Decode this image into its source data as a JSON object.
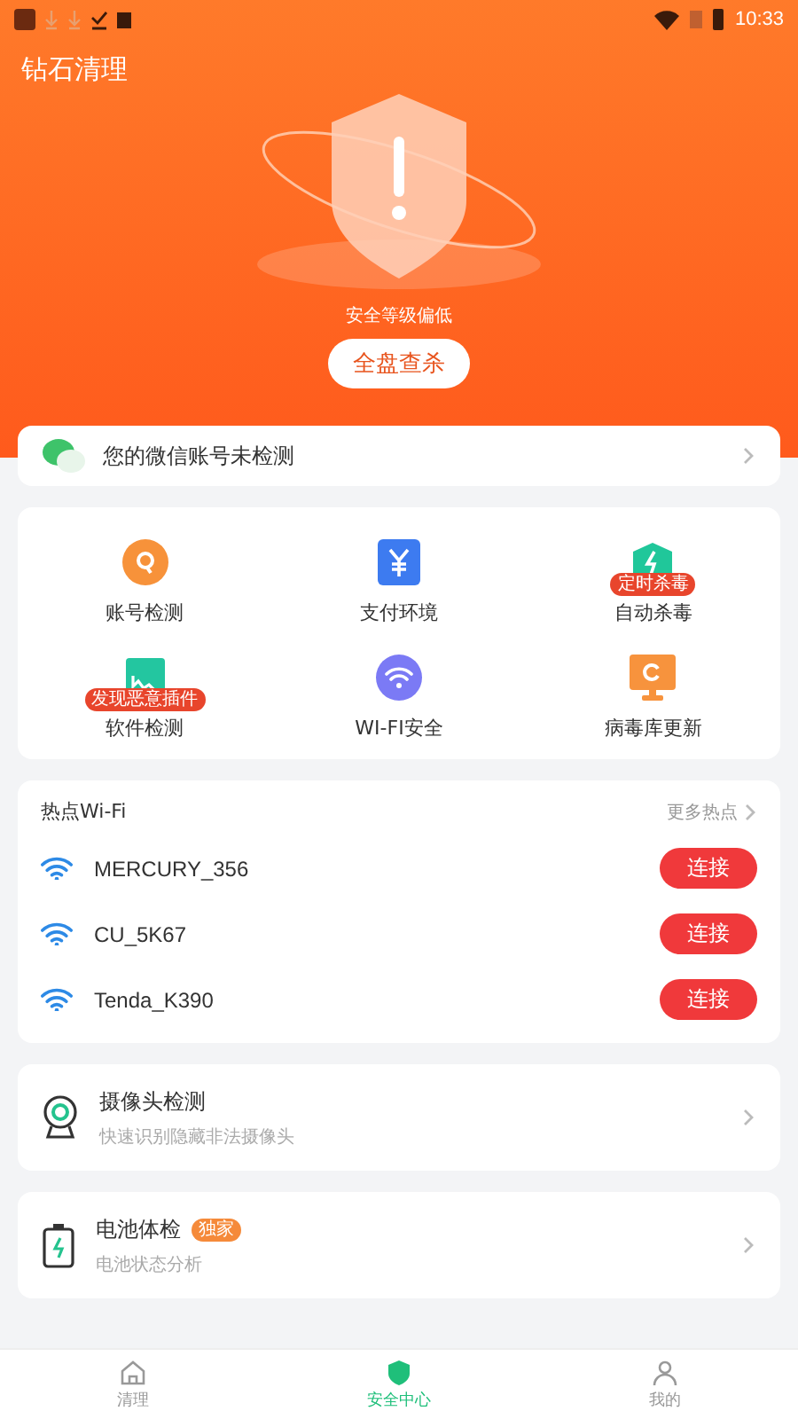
{
  "status_bar": {
    "time": "10:33"
  },
  "app_title": "钻石清理",
  "hero": {
    "status": "安全等级偏低",
    "scan_button": "全盘查杀"
  },
  "wechat_notice": {
    "text": "您的微信账号未检测"
  },
  "tools": [
    {
      "kind": "account",
      "label": "账号检测"
    },
    {
      "kind": "payment",
      "label": "支付环境"
    },
    {
      "kind": "antivirus",
      "label": "自动杀毒",
      "badge": "定时杀毒"
    },
    {
      "kind": "software",
      "label": "软件检测",
      "badge": "发现恶意插件"
    },
    {
      "kind": "wifi",
      "label": "WI-FI安全"
    },
    {
      "kind": "update",
      "label": "病毒库更新"
    }
  ],
  "hotspots": {
    "title": "热点Wi-Fi",
    "more": "更多热点",
    "networks": [
      {
        "name": "MERCURY_356",
        "action": "连接"
      },
      {
        "name": "CU_5K67",
        "action": "连接"
      },
      {
        "name": "Tenda_K390",
        "action": "连接"
      }
    ]
  },
  "features": [
    {
      "kind": "camera",
      "title": "摄像头检测",
      "subtitle": "快速识别隐藏非法摄像头"
    },
    {
      "kind": "battery",
      "title": "电池体检",
      "badge": "独家",
      "subtitle": "电池状态分析"
    }
  ],
  "nav": [
    {
      "kind": "home",
      "label": "清理",
      "selected": false
    },
    {
      "kind": "shield",
      "label": "安全中心",
      "selected": true
    },
    {
      "kind": "user",
      "label": "我的",
      "selected": false
    }
  ]
}
